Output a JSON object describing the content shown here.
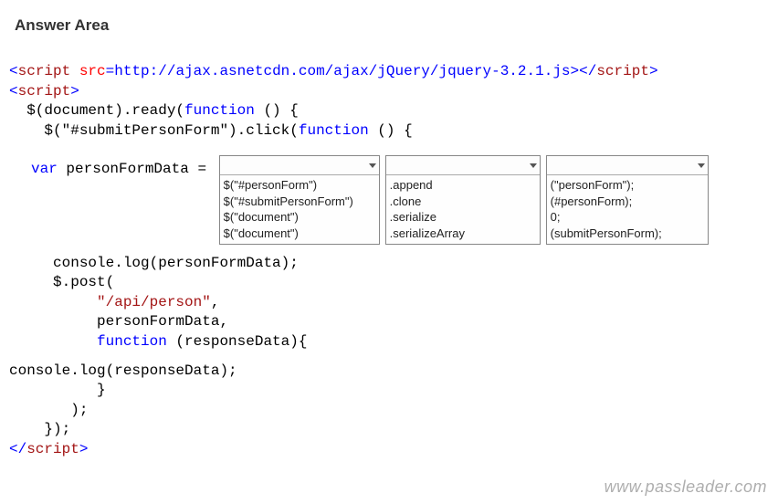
{
  "title": "Answer Area",
  "code": {
    "line_script_open_1": "<",
    "line_script_tag": "script",
    "line_src_attr": " src",
    "line_eq": "=",
    "line_url": "http://ajax.asnetcdn.com/ajax/jQuery/jquery-3.2.1.js",
    "line_gt": ">",
    "line_close_script1a": "</",
    "line_close_script1b": "script",
    "line_close_script1c": ">",
    "line_script2_open": "<",
    "line_script2": "script",
    "line_script2_gt": ">",
    "doc_ready": "  $(document).ready(",
    "func_kw": "function",
    "paren_space_open": " () {",
    "click_line": "    $(\"#submitPersonForm\").click(",
    "paren_space_open2": " () {",
    "var_kw": "var",
    "var_decl": " personFormData = ",
    "console1": "     console.log(personFormData);",
    "post1": "     $.post(",
    "post2_str": "\"/api/person\"",
    "post2_comma": ",",
    "post3": "          personFormData,",
    "post4_func": "function",
    "post4_rest": " (responseData){",
    "console2": "console.log(responseData);",
    "brace1": "          }",
    "close_paren": "       );",
    "close_click": "    });",
    "close_script_open": "</",
    "close_script": "script",
    "close_script_gt": ">"
  },
  "dropdown1": {
    "options": [
      "$(\"#personForm\")",
      "$(\"#submitPersonForm\")",
      "$(\"document\")",
      "$(\"document\")"
    ]
  },
  "dropdown2": {
    "options": [
      ".append",
      ".clone",
      ".serialize",
      ".serializeArray"
    ]
  },
  "dropdown3": {
    "options": [
      "(\"personForm\");",
      "(#personForm);",
      "0;",
      "(submitPersonForm);"
    ]
  },
  "watermark": "www.passleader.com"
}
